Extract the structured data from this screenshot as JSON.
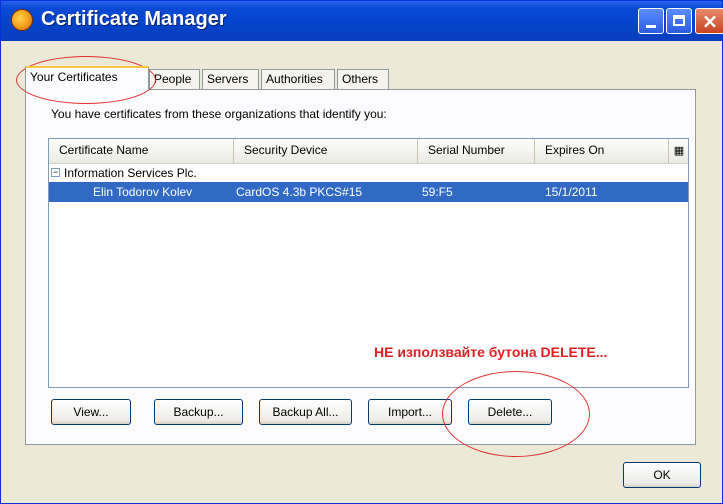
{
  "window": {
    "title": "Certificate Manager",
    "minimize_label": "Minimize",
    "maximize_label": "Maximize",
    "close_label": "Close"
  },
  "tabs": [
    {
      "label": "Your Certificates",
      "active": true
    },
    {
      "label": "People",
      "active": false
    },
    {
      "label": "Servers",
      "active": false
    },
    {
      "label": "Authorities",
      "active": false
    },
    {
      "label": "Others",
      "active": false
    }
  ],
  "intro_text": "You have certificates from these organizations that identify you:",
  "table": {
    "columns": [
      "Certificate Name",
      "Security Device",
      "Serial Number",
      "Expires On"
    ],
    "column_picker_icon": "column-picker-icon",
    "groups": [
      {
        "expander": "−",
        "name": "Information Services Plc.",
        "rows": [
          {
            "name": "Elin Todorov Kolev",
            "device": "CardOS 4.3b PKCS#15",
            "serial": "59:F5",
            "expires": "15/1/2011",
            "selected": true
          }
        ]
      }
    ]
  },
  "annotation": "НЕ използвайте бутона DELETE...",
  "buttons": {
    "view": "View...",
    "backup": "Backup...",
    "backup_all": "Backup All...",
    "import": "Import...",
    "delete": "Delete...",
    "ok": "OK"
  },
  "colors": {
    "accent": "#0a4ad6",
    "selection": "#316ac5",
    "annotation": "#e02020"
  }
}
